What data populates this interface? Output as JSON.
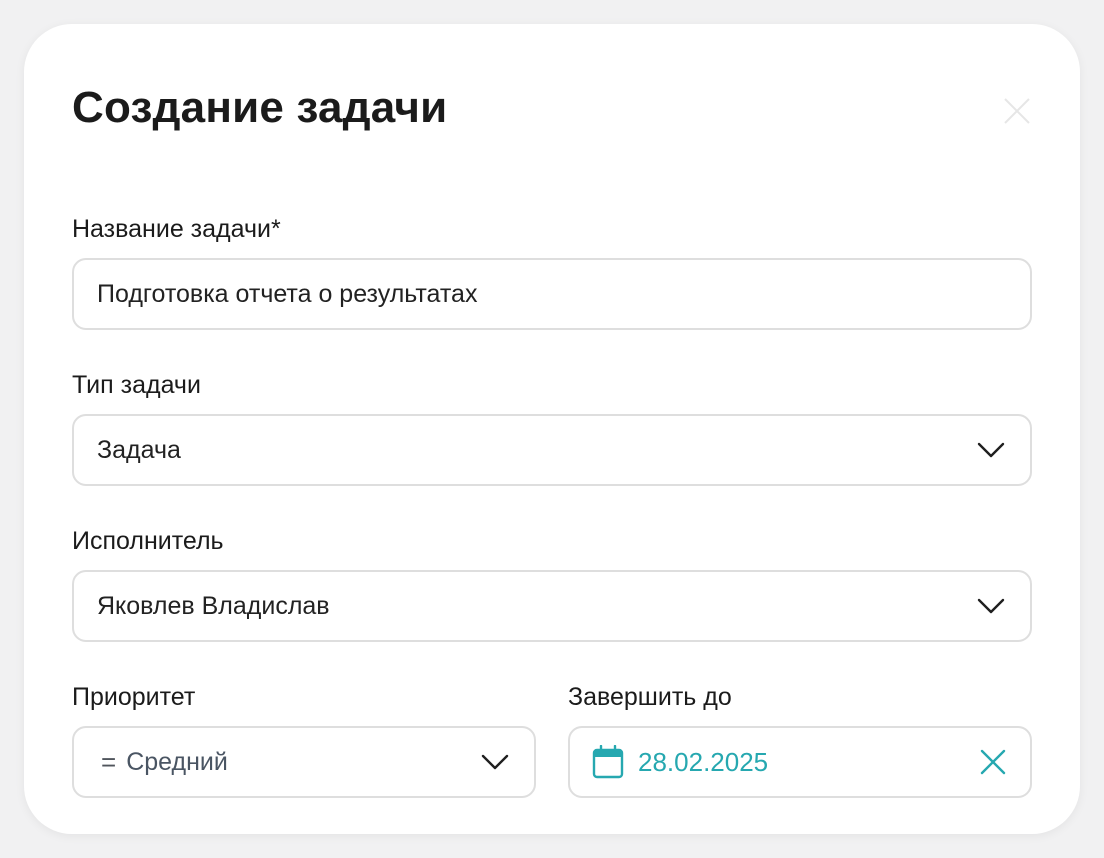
{
  "dialog": {
    "title": "Создание задачи"
  },
  "fields": {
    "task_name": {
      "label": "Название задачи*",
      "value": "Подготовка отчета о результатах"
    },
    "task_type": {
      "label": "Тип задачи",
      "value": "Задача"
    },
    "assignee": {
      "label": "Исполнитель",
      "value": "Яковлев Владислав"
    },
    "priority": {
      "label": "Приоритет",
      "symbol": "=",
      "value": "Средний"
    },
    "due_date": {
      "label": "Завершить до",
      "value": "28.02.2025"
    }
  },
  "icons": {
    "close": "close-icon",
    "chevron": "chevron-down-icon",
    "calendar": "calendar-icon",
    "clear": "clear-icon"
  },
  "colors": {
    "accent": "#26a8b0",
    "border": "#dedede",
    "text": "#1b1b1b",
    "background": "#f1f1f2"
  }
}
